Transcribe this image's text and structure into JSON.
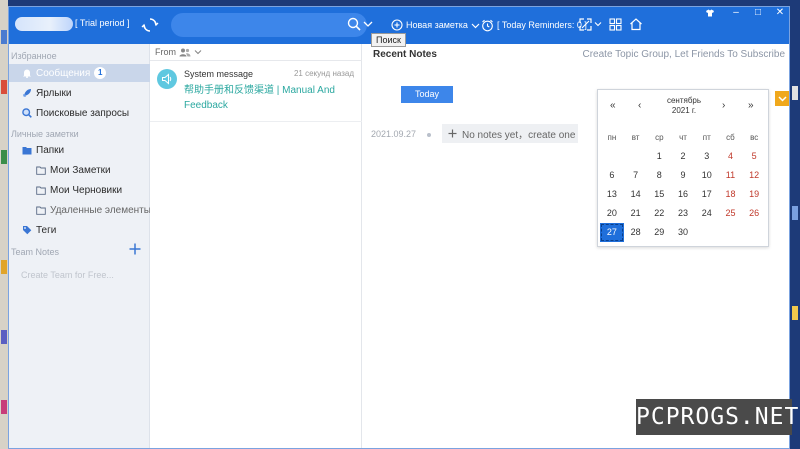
{
  "titlebar": {
    "trial": "[ Trial period ]",
    "new_note": "Новая заметка",
    "reminder": "[ Today Reminders: 0 ]"
  },
  "tooltip": "Поиск",
  "sidebar": {
    "favorites_header": "Избранное",
    "items": [
      {
        "label": "Сообщения",
        "badge": "1"
      },
      {
        "label": "Ярлыки"
      },
      {
        "label": "Поисковые запросы"
      }
    ],
    "personal_header": "Личные заметки",
    "folders": "Папки",
    "subfolders": [
      "Мои Заметки",
      "Мои Черновики",
      "Удаленные элементы"
    ],
    "tags": "Теги",
    "team_header": "Team Notes",
    "create_team": "Create Team for Free..."
  },
  "list": {
    "from_label": "From",
    "message": {
      "sender": "System message",
      "time": "21 секунд назад",
      "link": "帮助手册和反馈渠道 | Manual And Feedback"
    }
  },
  "main": {
    "title": "Recent Notes",
    "create_topic": "Create Topic Group, Let Friends To Subscribe",
    "today_button": "Today",
    "timeline_date": "2021.09.27",
    "no_notes": "No notes yet，create one"
  },
  "calendar": {
    "nav": {
      "prev_year": "«",
      "prev_month": "‹",
      "next_month": "›",
      "next_year": "»"
    },
    "month": "сентябрь",
    "year": "2021 г.",
    "weekdays": [
      "пн",
      "вт",
      "ср",
      "чт",
      "пт",
      "сб",
      "вс"
    ],
    "weeks": [
      [
        "",
        "",
        "1",
        "2",
        "3",
        "4",
        "5"
      ],
      [
        "6",
        "7",
        "8",
        "9",
        "10",
        "11",
        "12"
      ],
      [
        "13",
        "14",
        "15",
        "16",
        "17",
        "18",
        "19"
      ],
      [
        "20",
        "21",
        "22",
        "23",
        "24",
        "25",
        "26"
      ],
      [
        "27",
        "28",
        "29",
        "30",
        "",
        "",
        ""
      ]
    ],
    "selected_day": "27"
  },
  "watermark": "PCPROGS.NET",
  "colors": {
    "titlebar": "#1f6fdb",
    "accent": "#3d86ea",
    "link": "#2ba8a0",
    "weekend": "#c0392b",
    "close": "#f0a81c"
  }
}
